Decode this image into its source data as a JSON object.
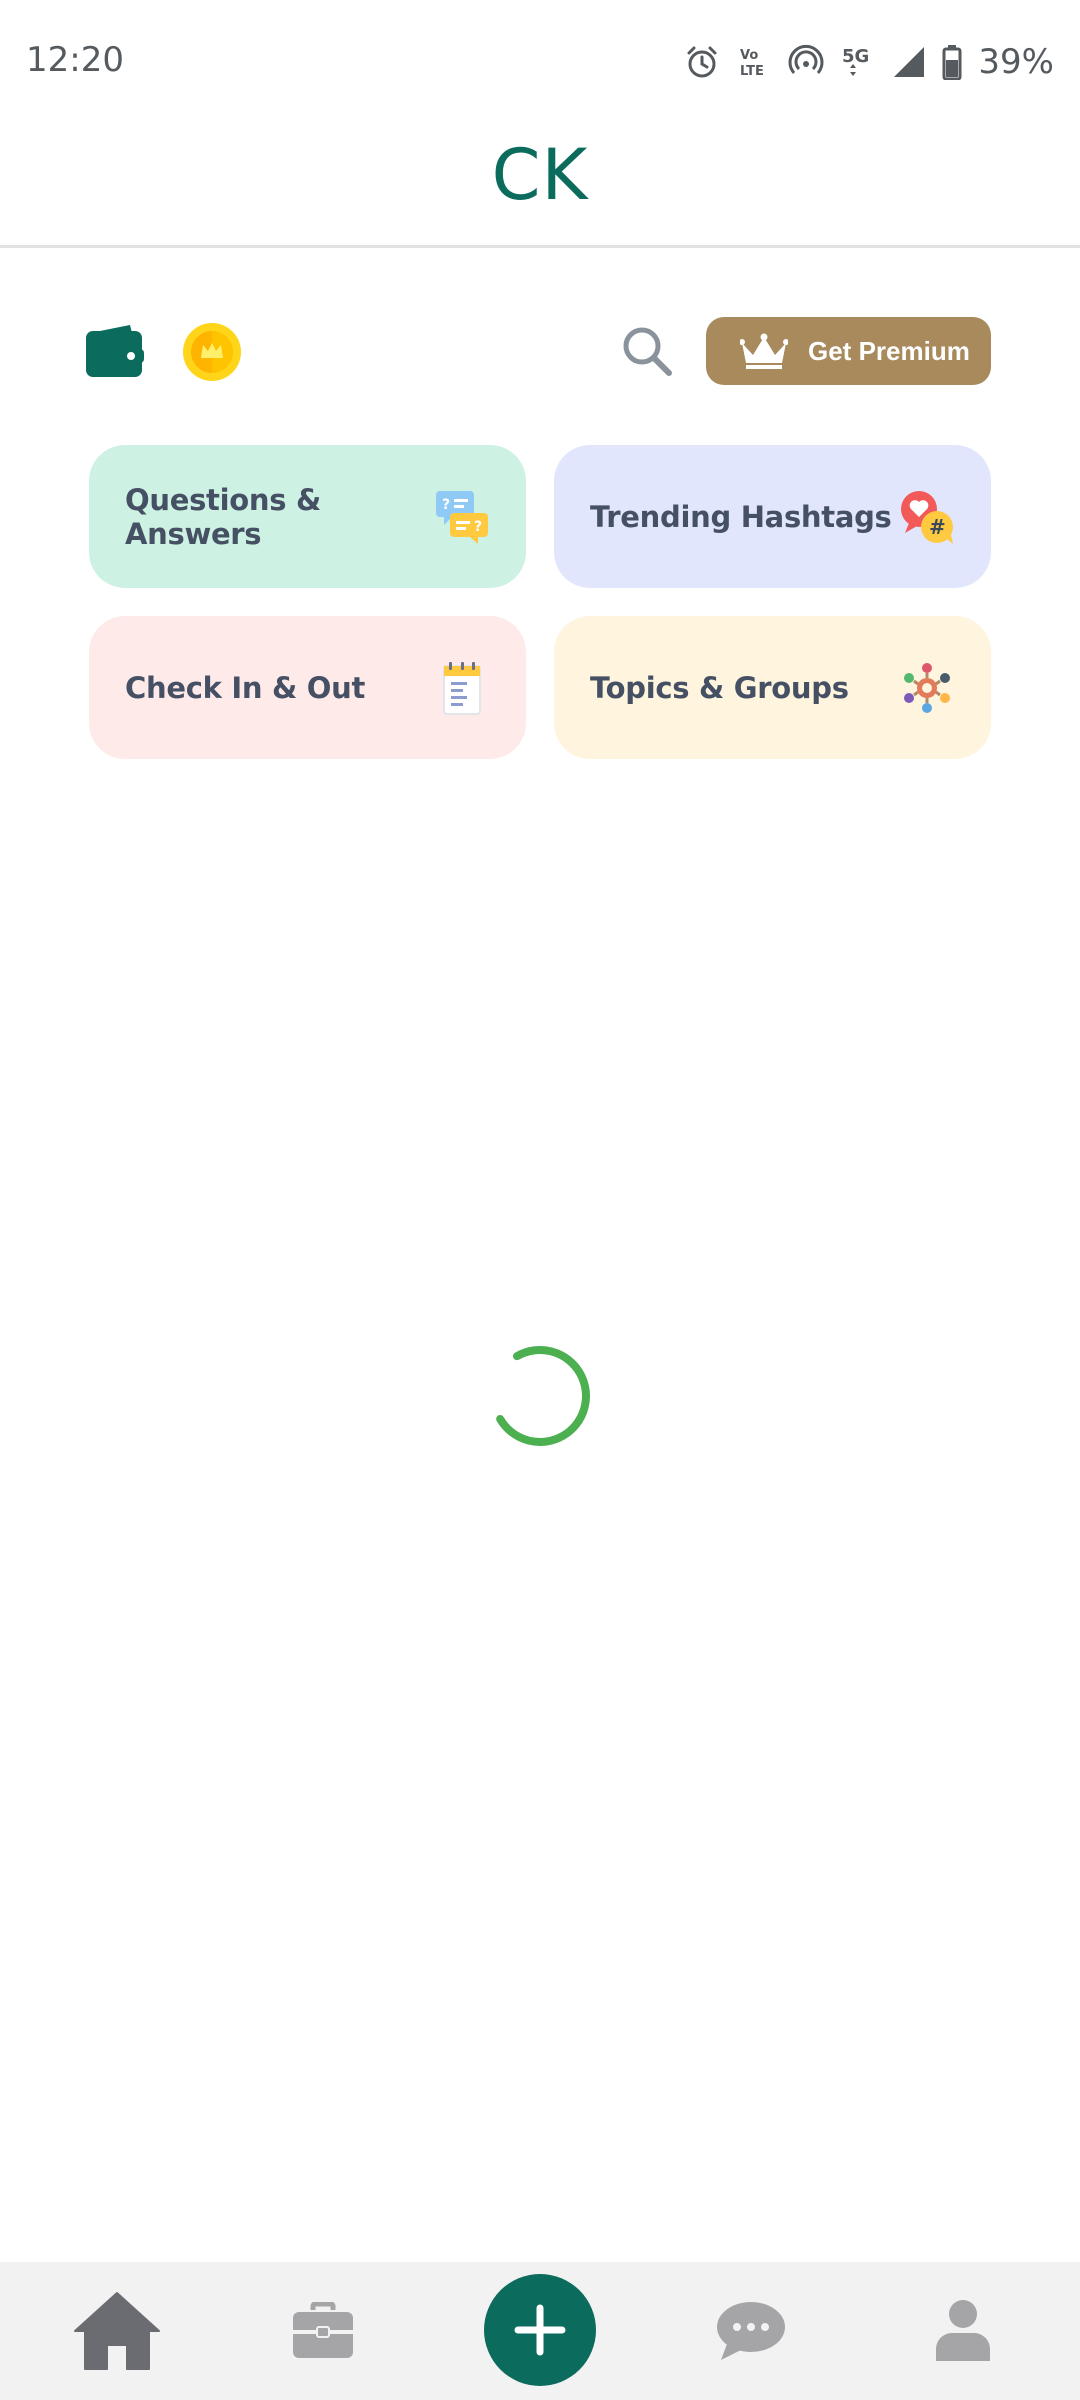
{
  "status_bar": {
    "time": "12:20",
    "battery": "39%",
    "network": "5G",
    "icons": [
      "alarm-icon",
      "volte-icon",
      "hotspot-icon",
      "5g-icon",
      "signal-icon",
      "battery-icon"
    ]
  },
  "header": {
    "title": "CK"
  },
  "toolbar": {
    "wallet_icon": "wallet-icon",
    "coin_icon": "coin-crown-icon",
    "search_icon": "search-icon",
    "premium_label": "Get Premium",
    "premium_color": "#a88a5d"
  },
  "categories": [
    {
      "label": "Questions & Answers",
      "icon": "qa-chat-icon",
      "color": "#cdf1e2"
    },
    {
      "label": "Trending Hashtags",
      "icon": "hashtag-heart-icon",
      "color": "#e1e6fd"
    },
    {
      "label": "Check In & Out",
      "icon": "checklist-icon",
      "color": "#ffeaea"
    },
    {
      "label": "Topics & Groups",
      "icon": "group-people-icon",
      "color": "#fff4dd"
    }
  ],
  "loading": {
    "spinner_color": "#4caf50"
  },
  "bottom_nav": {
    "items": [
      "home-icon",
      "briefcase-icon",
      "plus-icon",
      "chat-icon",
      "profile-icon"
    ],
    "accent": "#0b6b5c"
  }
}
